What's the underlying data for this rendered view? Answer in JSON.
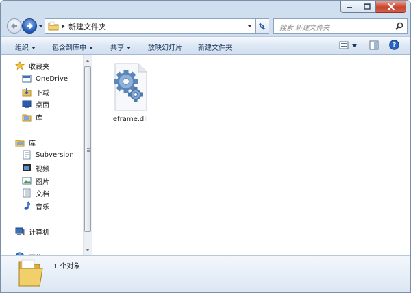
{
  "window": {
    "caption": {
      "minimize": "minimize",
      "maximize": "maximize",
      "close": "close"
    }
  },
  "address": {
    "path_item": "新建文件夹",
    "search_placeholder": "搜索 新建文件夹"
  },
  "toolbar": {
    "organize": "组织",
    "include_in_library": "包含到库中",
    "share": "共享",
    "slideshow": "放映幻灯片",
    "new_folder": "新建文件夹"
  },
  "navpane": {
    "favorites": "收藏夹",
    "onedrive": "OneDrive",
    "downloads": "下载",
    "desktop": "桌面",
    "recent_lib": "库",
    "libraries": "库",
    "subversion": "Subversion",
    "videos": "视频",
    "pictures": "图片",
    "documents": "文档",
    "music": "音乐",
    "computer": "计算机",
    "network": "网络"
  },
  "files": [
    {
      "name": "ieframe.dll",
      "icon": "dll-gear-icon"
    }
  ],
  "details": {
    "count": "1 个对象"
  },
  "colors": {
    "window_frame": "#cfdff0",
    "toolbar_text": "#1e395b",
    "close_button": "#c8452f"
  }
}
